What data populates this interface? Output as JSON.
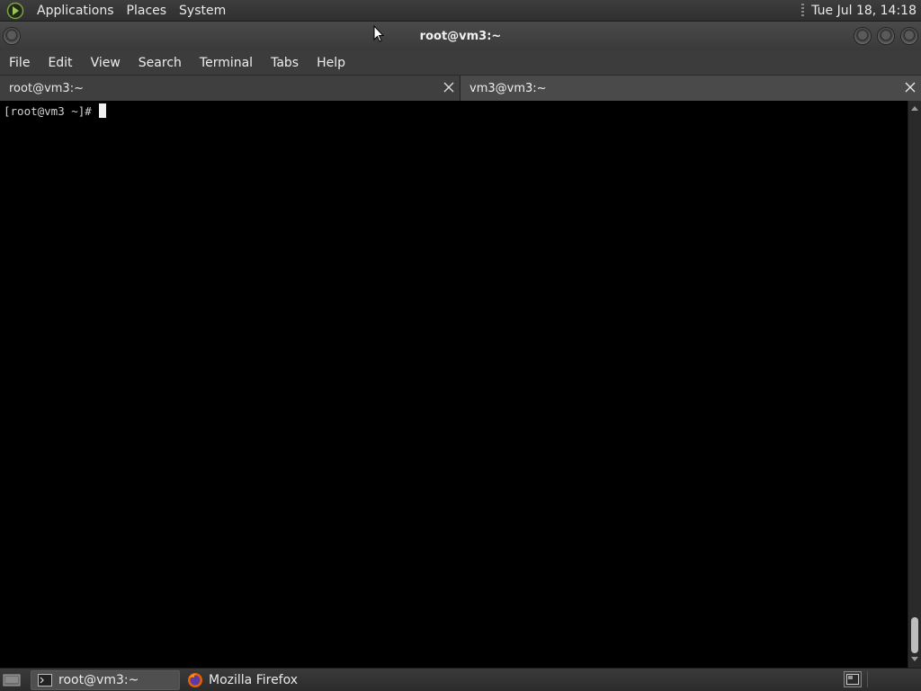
{
  "top_panel": {
    "menus": [
      "Applications",
      "Places",
      "System"
    ],
    "clock": "Tue Jul 18, 14:18"
  },
  "window": {
    "title": "root@vm3:~"
  },
  "menubar": {
    "items": [
      "File",
      "Edit",
      "View",
      "Search",
      "Terminal",
      "Tabs",
      "Help"
    ]
  },
  "tabs": [
    {
      "label": "root@vm3:~",
      "active": true
    },
    {
      "label": "vm3@vm3:~",
      "active": false
    }
  ],
  "terminal": {
    "prompt": "[root@vm3 ~]#"
  },
  "taskbar": {
    "tasks": [
      {
        "label": "root@vm3:~",
        "icon": "terminal-icon",
        "active": true
      },
      {
        "label": "Mozilla Firefox",
        "icon": "firefox-icon",
        "active": false
      }
    ]
  },
  "colors": {
    "terminal_bg": "#000000",
    "panel_bg": "#3a3a3a",
    "text": "#eaeaea"
  }
}
